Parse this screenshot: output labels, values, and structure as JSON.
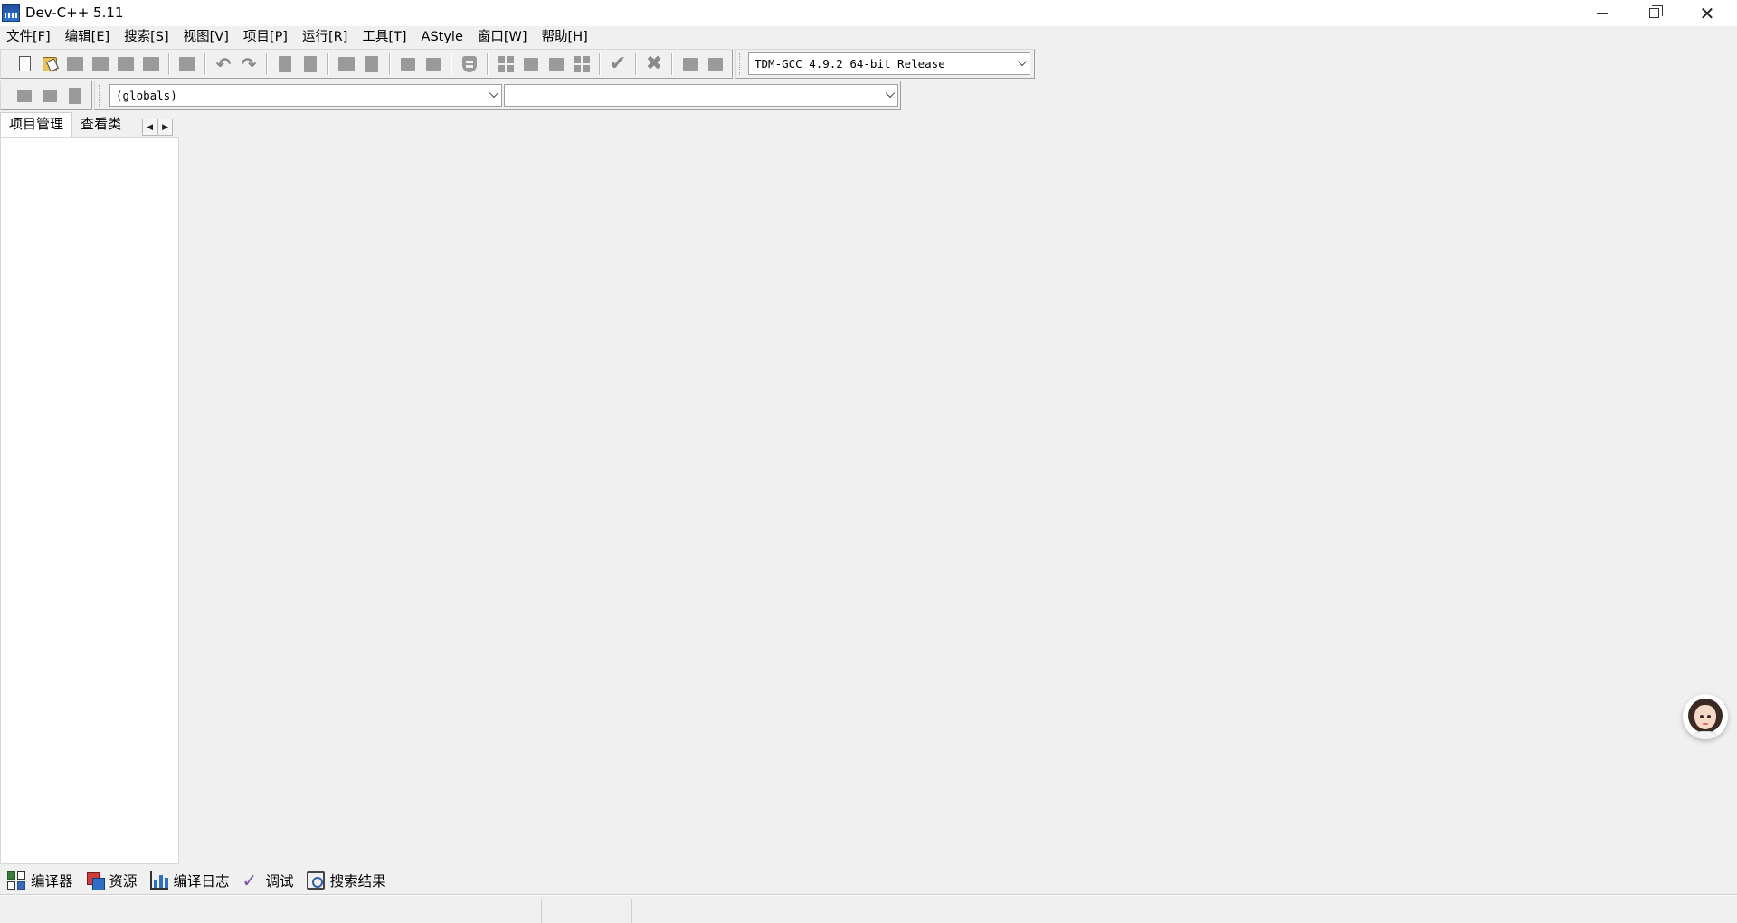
{
  "window": {
    "title": "Dev-C++ 5.11"
  },
  "menu": [
    "文件[F]",
    "编辑[E]",
    "搜索[S]",
    "视图[V]",
    "项目[P]",
    "运行[R]",
    "工具[T]",
    "AStyle",
    "窗口[W]",
    "帮助[H]"
  ],
  "toolbar": {
    "compiler_selected": "TDM-GCC 4.9.2 64-bit Release"
  },
  "classbar": {
    "scope_selected": "(globals)",
    "function_selected": ""
  },
  "left_tabs": [
    "项目管理",
    "查看类"
  ],
  "bottom_tabs": [
    "编译器",
    "资源",
    "编译日志",
    "调试",
    "搜索结果"
  ],
  "icons": {
    "app": "dev-cpp-icon",
    "minimize": "minimize-icon",
    "maximize": "restore-icon",
    "close": "close-icon",
    "assistant": "assistant-avatar-icon"
  }
}
